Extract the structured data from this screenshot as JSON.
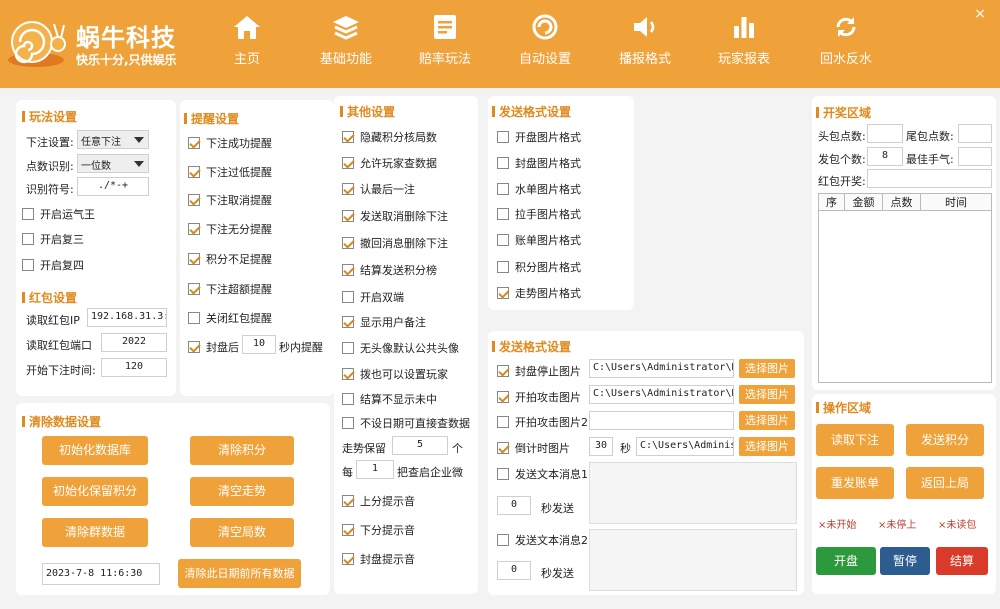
{
  "header": {
    "brand": "蜗牛科技",
    "slogan": "快乐十分,只供娱乐",
    "close": "×",
    "nav": [
      {
        "label": "主页",
        "icon": "home-icon"
      },
      {
        "label": "基础功能",
        "icon": "layers-icon"
      },
      {
        "label": "赔率玩法",
        "icon": "document-icon"
      },
      {
        "label": "自动设置",
        "icon": "spiral-icon"
      },
      {
        "label": "播报格式",
        "icon": "speaker-icon"
      },
      {
        "label": "玩家报表",
        "icon": "bar-chart-icon"
      },
      {
        "label": "回水反水",
        "icon": "refresh-icon"
      }
    ]
  },
  "play": {
    "title": "玩法设置",
    "bet_label": "下注设置:",
    "bet_value": "任意下注",
    "digit_label": "点数识别:",
    "digit_value": "一位数",
    "symbol_label": "识别符号:",
    "symbol_value": "./*-+",
    "checks": [
      {
        "label": "开启运气王",
        "on": false
      },
      {
        "label": "开启复三",
        "on": false
      },
      {
        "label": "开启复四",
        "on": false
      }
    ]
  },
  "redpack": {
    "title": "红包设置",
    "ip_label": "读取红包IP",
    "ip_value": "192.168.31.3:",
    "port_label": "读取红包端口",
    "port_value": "2022",
    "time_label": "开始下注时间:",
    "time_value": "120"
  },
  "remind": {
    "title": "提醒设置",
    "checks": [
      {
        "label": "下注成功提醒",
        "on": true
      },
      {
        "label": "下注过低提醒",
        "on": true
      },
      {
        "label": "下注取消提醒",
        "on": true
      },
      {
        "label": "下注无分提醒",
        "on": true
      },
      {
        "label": "积分不足提醒",
        "on": true
      },
      {
        "label": "下注超额提醒",
        "on": true
      },
      {
        "label": "关闭红包提醒",
        "on": false
      }
    ],
    "seal_label": "封盘后",
    "seal_value": "10",
    "seal_suffix": "秒内提醒"
  },
  "other": {
    "title": "其他设置",
    "checks": [
      {
        "label": "隐藏积分核局数",
        "on": true
      },
      {
        "label": "允许玩家查数据",
        "on": true
      },
      {
        "label": "认最后一注",
        "on": true
      },
      {
        "label": "发送取消删除下注",
        "on": true
      },
      {
        "label": "撤回消息删除下注",
        "on": true
      },
      {
        "label": "结算发送积分榜",
        "on": true
      },
      {
        "label": "开启双端",
        "on": false
      },
      {
        "label": "显示用户备注",
        "on": true
      },
      {
        "label": "无头像默认公共头像",
        "on": false
      },
      {
        "label": "拨也可以设置玩家",
        "on": true
      },
      {
        "label": "结算不显示未中",
        "on": false
      },
      {
        "label": "不设日期可直接查数据",
        "on": false
      }
    ],
    "trend_label": "走势保留",
    "trend_value": "5",
    "trend_unit": "个",
    "each_label": "每",
    "each_value": "1",
    "each_suffix": "把查启企业微",
    "sounds": [
      {
        "label": "上分提示音",
        "on": true
      },
      {
        "label": "下分提示音",
        "on": true
      },
      {
        "label": "封盘提示音",
        "on": true
      }
    ]
  },
  "sendfmt1": {
    "title": "发送格式设置",
    "checks": [
      {
        "label": "开盘图片格式",
        "on": false
      },
      {
        "label": "封盘图片格式",
        "on": false
      },
      {
        "label": "水单图片格式",
        "on": false
      },
      {
        "label": "拉手图片格式",
        "on": false
      },
      {
        "label": "账单图片格式",
        "on": false
      },
      {
        "label": "积分图片格式",
        "on": false
      },
      {
        "label": "走势图片格式",
        "on": true
      }
    ]
  },
  "sendfmt2": {
    "title": "发送格式设置",
    "rows": [
      {
        "label": "封盘停止图片",
        "on": true,
        "path": "C:\\Users\\Administrator\\De:",
        "btn": "选择图片"
      },
      {
        "label": "开拍攻击图片",
        "on": true,
        "path": "C:\\Users\\Administrator\\De:",
        "btn": "选择图片"
      },
      {
        "label": "开拍攻击图片2",
        "on": false,
        "path": "",
        "btn": "选择图片"
      }
    ],
    "countdown_label": "倒计时图片",
    "countdown_on": true,
    "countdown_value": "30",
    "countdown_unit": "秒",
    "countdown_path": "C:\\Users\\Administ",
    "countdown_btn": "选择图片",
    "msg1_label": "发送文本消息1",
    "msg1_value": "0",
    "msg1_suffix": "秒发送",
    "msg2_label": "发送文本消息2",
    "msg2_value": "0",
    "msg2_suffix": "秒发送"
  },
  "clear": {
    "title": "清除数据设置",
    "buttons": [
      "初始化数据库",
      "清除积分",
      "初始化保留积分",
      "清空走势",
      "清除群数据",
      "清空局数"
    ],
    "date_value": "2023-7-8 11:6:30",
    "date_btn": "清除此日期前所有数据"
  },
  "lottery": {
    "title": "开奖区域",
    "head_label": "头包点数:",
    "tail_label": "尾包点数:",
    "count_label": "发包个数:",
    "count_value": "8",
    "best_label": "最佳手气:",
    "open_label": "红包开奖:",
    "columns": [
      "序",
      "金额",
      "点数",
      "时间"
    ]
  },
  "ops": {
    "title": "操作区域",
    "buttons": [
      "读取下注",
      "发送积分",
      "重发账单",
      "返回上局"
    ],
    "status": [
      "×未开始",
      "×未停上",
      "×未读包"
    ],
    "start": "开盘",
    "pause": "暂停",
    "settle": "结算",
    "colors": {
      "start": "#2c9a3c",
      "pause": "#2d5d8f",
      "settle": "#d93a2a"
    }
  }
}
